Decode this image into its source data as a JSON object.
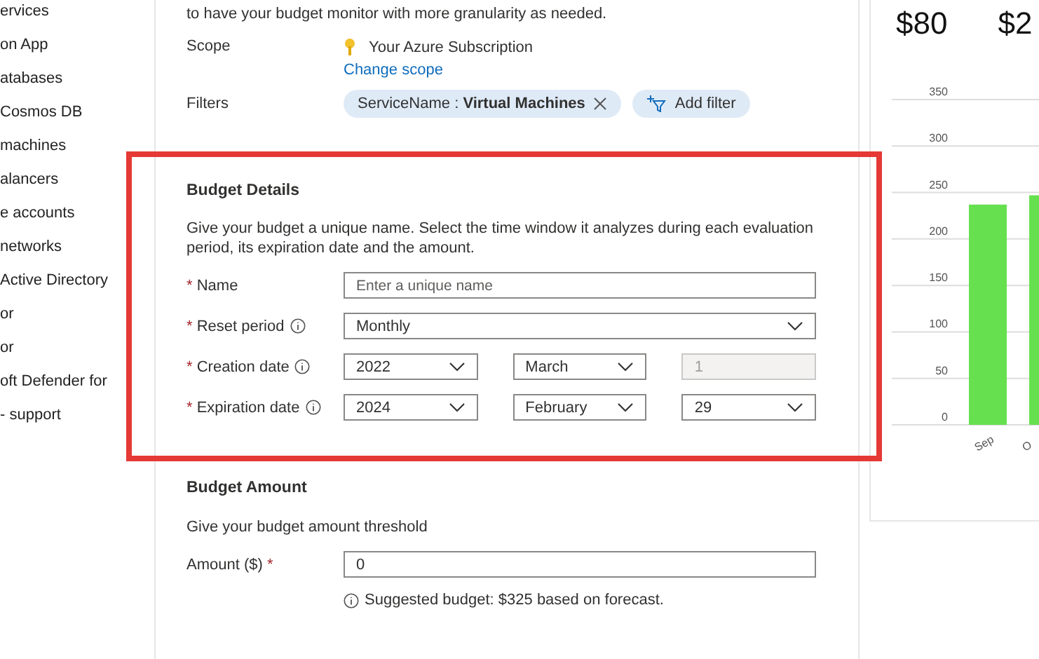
{
  "sidebar": {
    "items": [
      {
        "label": "ervices"
      },
      {
        "label": "on App"
      },
      {
        "label": "atabases"
      },
      {
        "label": "Cosmos DB"
      },
      {
        "label": " machines"
      },
      {
        "label": "alancers"
      },
      {
        "label": "e accounts"
      },
      {
        "label": " networks"
      },
      {
        "label": "Active Directory"
      },
      {
        "label": "or"
      },
      {
        "label": "or"
      },
      {
        "label": "oft Defender for"
      },
      {
        "label": "- support"
      }
    ]
  },
  "intro": "to have your budget monitor with more granularity as needed.",
  "scope": {
    "label": "Scope",
    "value": "Your Azure Subscription",
    "link": "Change scope"
  },
  "filters": {
    "label": "Filters",
    "chips": [
      {
        "kind": "filter",
        "name": "ServiceName : ",
        "value": "Virtual Machines"
      },
      {
        "kind": "add",
        "name": "Add filter"
      }
    ]
  },
  "budget_details": {
    "title": "Budget Details",
    "description": "Give your budget a unique name. Select the time window it analyzes during each evaluation period, its expiration date and the amount.",
    "fields": [
      {
        "label": "Name",
        "required": "*",
        "info": false,
        "controls": [
          {
            "kind": "text",
            "placeholder": "Enter a unique name",
            "disabled": false
          }
        ]
      },
      {
        "label": "Reset period",
        "required": "*",
        "info": true,
        "controls": [
          {
            "kind": "select",
            "value": "Monthly",
            "disabled": false
          }
        ]
      },
      {
        "label": "Creation date",
        "required": "*",
        "info": true,
        "controls": [
          {
            "kind": "select",
            "value": "2022",
            "disabled": false
          },
          {
            "kind": "select",
            "value": "March",
            "disabled": false
          },
          {
            "kind": "text",
            "value": "1",
            "disabled": true
          }
        ]
      },
      {
        "label": "Expiration date",
        "required": "*",
        "info": true,
        "controls": [
          {
            "kind": "select",
            "value": "2024",
            "disabled": false
          },
          {
            "kind": "select",
            "value": "February",
            "disabled": false
          },
          {
            "kind": "select",
            "value": "29",
            "disabled": false
          }
        ]
      }
    ]
  },
  "budget_amount": {
    "title": "Budget Amount",
    "description": "Give your budget amount threshold",
    "label": "Amount ($)",
    "required": "*",
    "value": "0",
    "hint": "Suggested budget: $325 based on forecast."
  },
  "summary": {
    "amounts": [
      "$80",
      "$2"
    ],
    "chart_data": {
      "type": "bar",
      "grid": true,
      "categories": [
        "Sep",
        "O"
      ],
      "values": [
        237,
        247
      ],
      "ylim": [
        0,
        350
      ],
      "yticks": [
        0,
        50,
        100,
        150,
        200,
        250,
        300,
        350
      ]
    }
  }
}
